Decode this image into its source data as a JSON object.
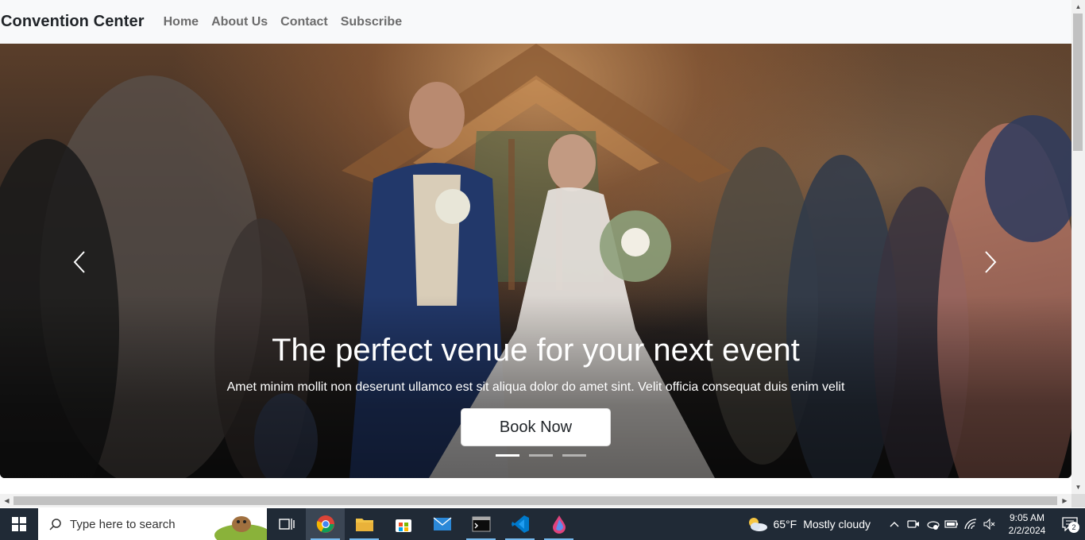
{
  "navbar": {
    "brand": "Convention Center",
    "links": [
      "Home",
      "About Us",
      "Contact",
      "Subscribe"
    ]
  },
  "carousel": {
    "heading": "The perfect venue for your next event",
    "text": "Amet minim mollit non deserunt ullamco est sit aliqua dolor do amet sint. Velit officia consequat duis enim velit",
    "button": "Book Now",
    "slide_count": 3,
    "active_slide": 0,
    "prev_icon": "chevron-left-icon",
    "next_icon": "chevron-right-icon"
  },
  "taskbar": {
    "search_placeholder": "Type here to search",
    "apps": [
      "task-view",
      "chrome",
      "file-explorer",
      "microsoft-store",
      "mail",
      "terminal",
      "vs-code",
      "paint"
    ],
    "active_app": "chrome",
    "weather": {
      "temp": "65°F",
      "condition": "Mostly cloudy"
    },
    "time": "9:05 AM",
    "date": "2/2/2024",
    "notification_count": "2"
  },
  "colors": {
    "navbar_bg": "#f8f9fa",
    "taskbar_bg": "#202a36",
    "accent": "#76b9ed"
  }
}
